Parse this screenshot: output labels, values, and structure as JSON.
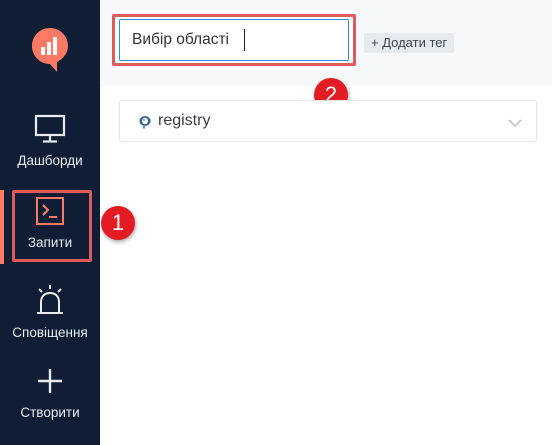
{
  "sidebar": {
    "items": [
      {
        "label": "Дашборди",
        "icon": "monitor-icon"
      },
      {
        "label": "Запити",
        "icon": "terminal-icon"
      },
      {
        "label": "Сповіщення",
        "icon": "alarm-icon"
      },
      {
        "label": "Створити",
        "icon": "plus-icon"
      }
    ],
    "active_index": 1,
    "logo_icon": "redash-logo-icon"
  },
  "header": {
    "query_name": "Вибір області",
    "add_tag_label": "+ Додати тег"
  },
  "datasource": {
    "selected": "registry",
    "icon": "postgresql-icon"
  },
  "annotations": [
    {
      "number": "1"
    },
    {
      "number": "2"
    }
  ],
  "colors": {
    "sidebar_bg": "#0f1e34",
    "accent": "#ff7964",
    "annotation": "#e05a5a",
    "badge": "#e31b23",
    "input_focus": "#2c8ce6"
  }
}
